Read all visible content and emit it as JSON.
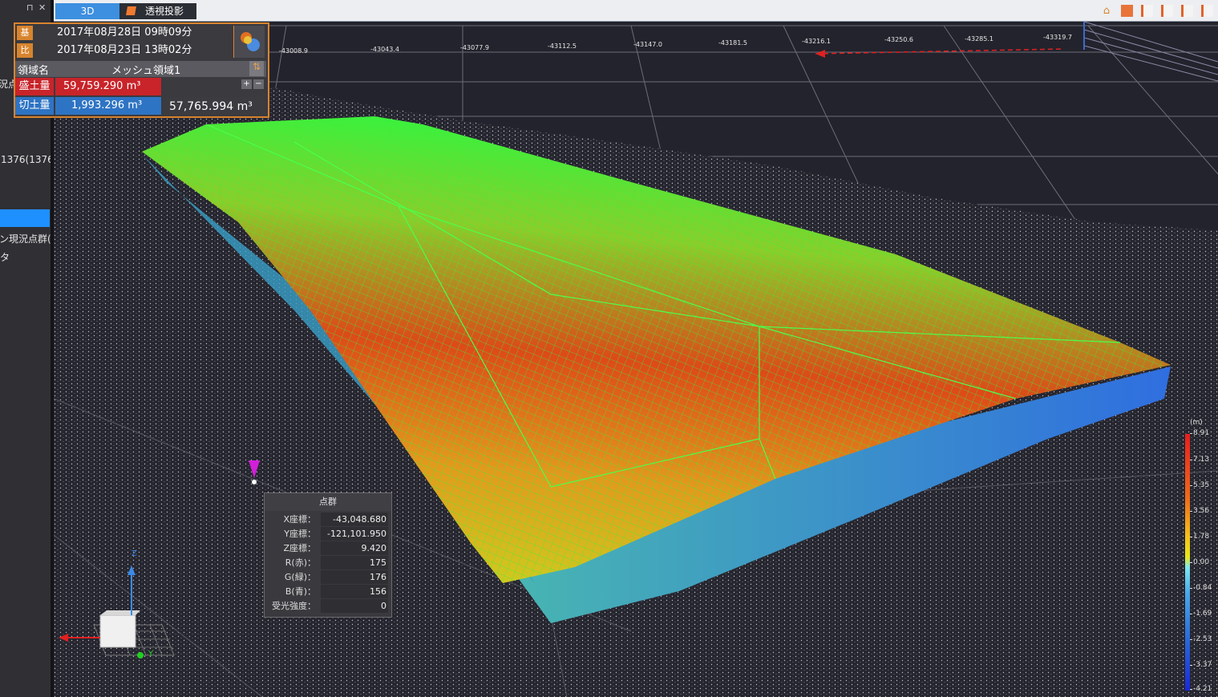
{
  "left_panel": {
    "pin_icon": "pin-icon",
    "close_icon": "close-icon",
    "items": [
      "況点",
      "1376(1376",
      "ン現況点群(",
      "タ"
    ]
  },
  "tabs": {
    "t3d": "3D",
    "persp": "透視投影"
  },
  "toolbar_icons": [
    "home-icon",
    "box-icon",
    "page-icon",
    "page-icon",
    "page-icon",
    "page-icon"
  ],
  "info": {
    "base_tag": "基",
    "base_date": "2017年08月28日 09時09分",
    "cmp_tag": "比",
    "cmp_date": "2017年08月23日 13時02分",
    "region_label": "領域名",
    "region_name": "メッシュ領域1",
    "fill_label": "盛土量",
    "fill_value": "59,759.290 m³",
    "cut_label": "切土量",
    "cut_value": "1,993.296 m³",
    "net_value": "57,765.994 m³",
    "plus": "+",
    "minus": "−"
  },
  "axis_labels": [
    "-43008.9",
    "-43043.4",
    "-43077.9",
    "-43112.5",
    "-43147.0",
    "-43181.5",
    "-43216.1",
    "-43250.6",
    "-43285.1",
    "-43319.7"
  ],
  "point_panel": {
    "title": "点群",
    "rows": [
      {
        "label": "X座標：",
        "value": "-43,048.680"
      },
      {
        "label": "Y座標：",
        "value": "-121,101.950"
      },
      {
        "label": "Z座標：",
        "value": "9.420"
      },
      {
        "label": "R(赤)：",
        "value": "175"
      },
      {
        "label": "G(緑)：",
        "value": "176"
      },
      {
        "label": "B(青)：",
        "value": "156"
      },
      {
        "label": "受光強度：",
        "value": "0"
      }
    ]
  },
  "legend": {
    "unit": "(m)",
    "ticks": [
      "8.91",
      "7.13",
      "5.35",
      "3.56",
      "1.78",
      "0.00",
      "-0.84",
      "-1.69",
      "-2.53",
      "-3.37",
      "-4.21"
    ]
  },
  "gizmo": {
    "z": "Z",
    "y": "Y"
  },
  "colors": {
    "accent": "#d8842e",
    "fill": "#c8242a",
    "cut": "#2e74c4",
    "mesh": "#3cf03c"
  }
}
